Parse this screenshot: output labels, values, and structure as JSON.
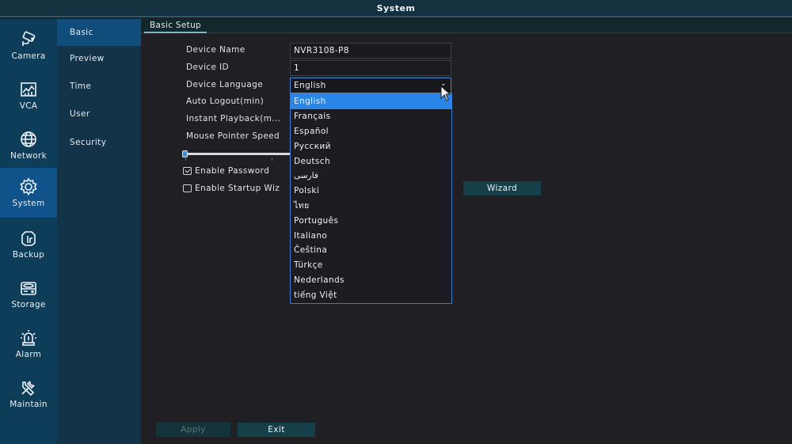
{
  "window": {
    "title": "System"
  },
  "main_nav": {
    "items": [
      {
        "label": "Camera",
        "icon": "camera-icon",
        "active": false
      },
      {
        "label": "VCA",
        "icon": "vca-icon",
        "active": false
      },
      {
        "label": "Network",
        "icon": "globe-icon",
        "active": false
      },
      {
        "label": "System",
        "icon": "gear-icon",
        "active": true
      },
      {
        "label": "Backup",
        "icon": "backup-icon",
        "active": false
      },
      {
        "label": "Storage",
        "icon": "hard-drive-icon",
        "active": false
      },
      {
        "label": "Alarm",
        "icon": "alarm-siren-icon",
        "active": false
      },
      {
        "label": "Maintain",
        "icon": "tools-icon",
        "active": false
      }
    ]
  },
  "sub_nav": {
    "items": [
      {
        "label": "Basic",
        "active": true
      },
      {
        "label": "Preview",
        "active": false
      },
      {
        "label": "Time",
        "active": false
      },
      {
        "label": "User",
        "active": false
      },
      {
        "label": "Security",
        "active": false
      }
    ]
  },
  "tabs": [
    {
      "label": "Basic Setup",
      "active": true
    }
  ],
  "form": {
    "device_name": {
      "label": "Device Name",
      "value": "NVR3108-P8"
    },
    "device_id": {
      "label": "Device ID",
      "value": "1"
    },
    "device_language": {
      "label": "Device Language",
      "value": "English"
    },
    "auto_logout": {
      "label": "Auto Logout(min)"
    },
    "instant_playback": {
      "label": "Instant Playback(m..."
    },
    "mouse_pointer_speed": {
      "label": "Mouse Pointer Speed",
      "level": 0
    },
    "enable_password": {
      "label": "Enable Password",
      "checked": true
    },
    "enable_startup_wizard": {
      "label": "Enable Startup Wiz",
      "checked": false
    },
    "wizard_button": "Wizard"
  },
  "language_dropdown": {
    "open": true,
    "selected": "English",
    "options": [
      "English",
      "Français",
      "Español",
      "Русский",
      "Deutsch",
      "فارسی",
      "Polski",
      "ไทย",
      "Português",
      "Italiano",
      "Čeština",
      "Türkçe",
      "Nederlands",
      "tiếng Việt"
    ]
  },
  "footer": {
    "apply_label": "Apply",
    "exit_label": "Exit",
    "apply_enabled": false
  },
  "colors": {
    "accent": "#2a86e6",
    "active_nav": "#10528a",
    "nav_bg": "#0e3d5a"
  }
}
